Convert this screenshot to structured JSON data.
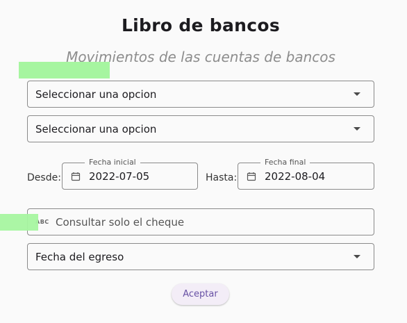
{
  "page": {
    "title": "Libro de bancos",
    "subtitle": "Movimientos de las cuentas de bancos"
  },
  "form": {
    "select_account_1": {
      "value": "Seleccionar una opcion"
    },
    "select_account_2": {
      "value": "Seleccionar una opcion"
    },
    "desde_label": "Desde:",
    "hasta_label": "Hasta:",
    "fecha_inicial": {
      "label": "Fecha inicial",
      "value": "2022-07-05"
    },
    "fecha_final": {
      "label": "Fecha final",
      "value": "2022-08-04"
    },
    "cheque": {
      "icon_text": "ABC",
      "placeholder": "Consultar solo el cheque"
    },
    "order_by": {
      "value": "Fecha del egreso"
    },
    "submit_label": "Aceptar"
  },
  "colors": {
    "highlight": "#a6f5a0",
    "button_bg": "#f3edf7",
    "button_text": "#6750a4",
    "subtitle": "#8d8d8d"
  },
  "icons": {
    "calendar": "calendar-icon",
    "abc": "abc-icon",
    "dropdown": "dropdown-arrow-icon"
  }
}
